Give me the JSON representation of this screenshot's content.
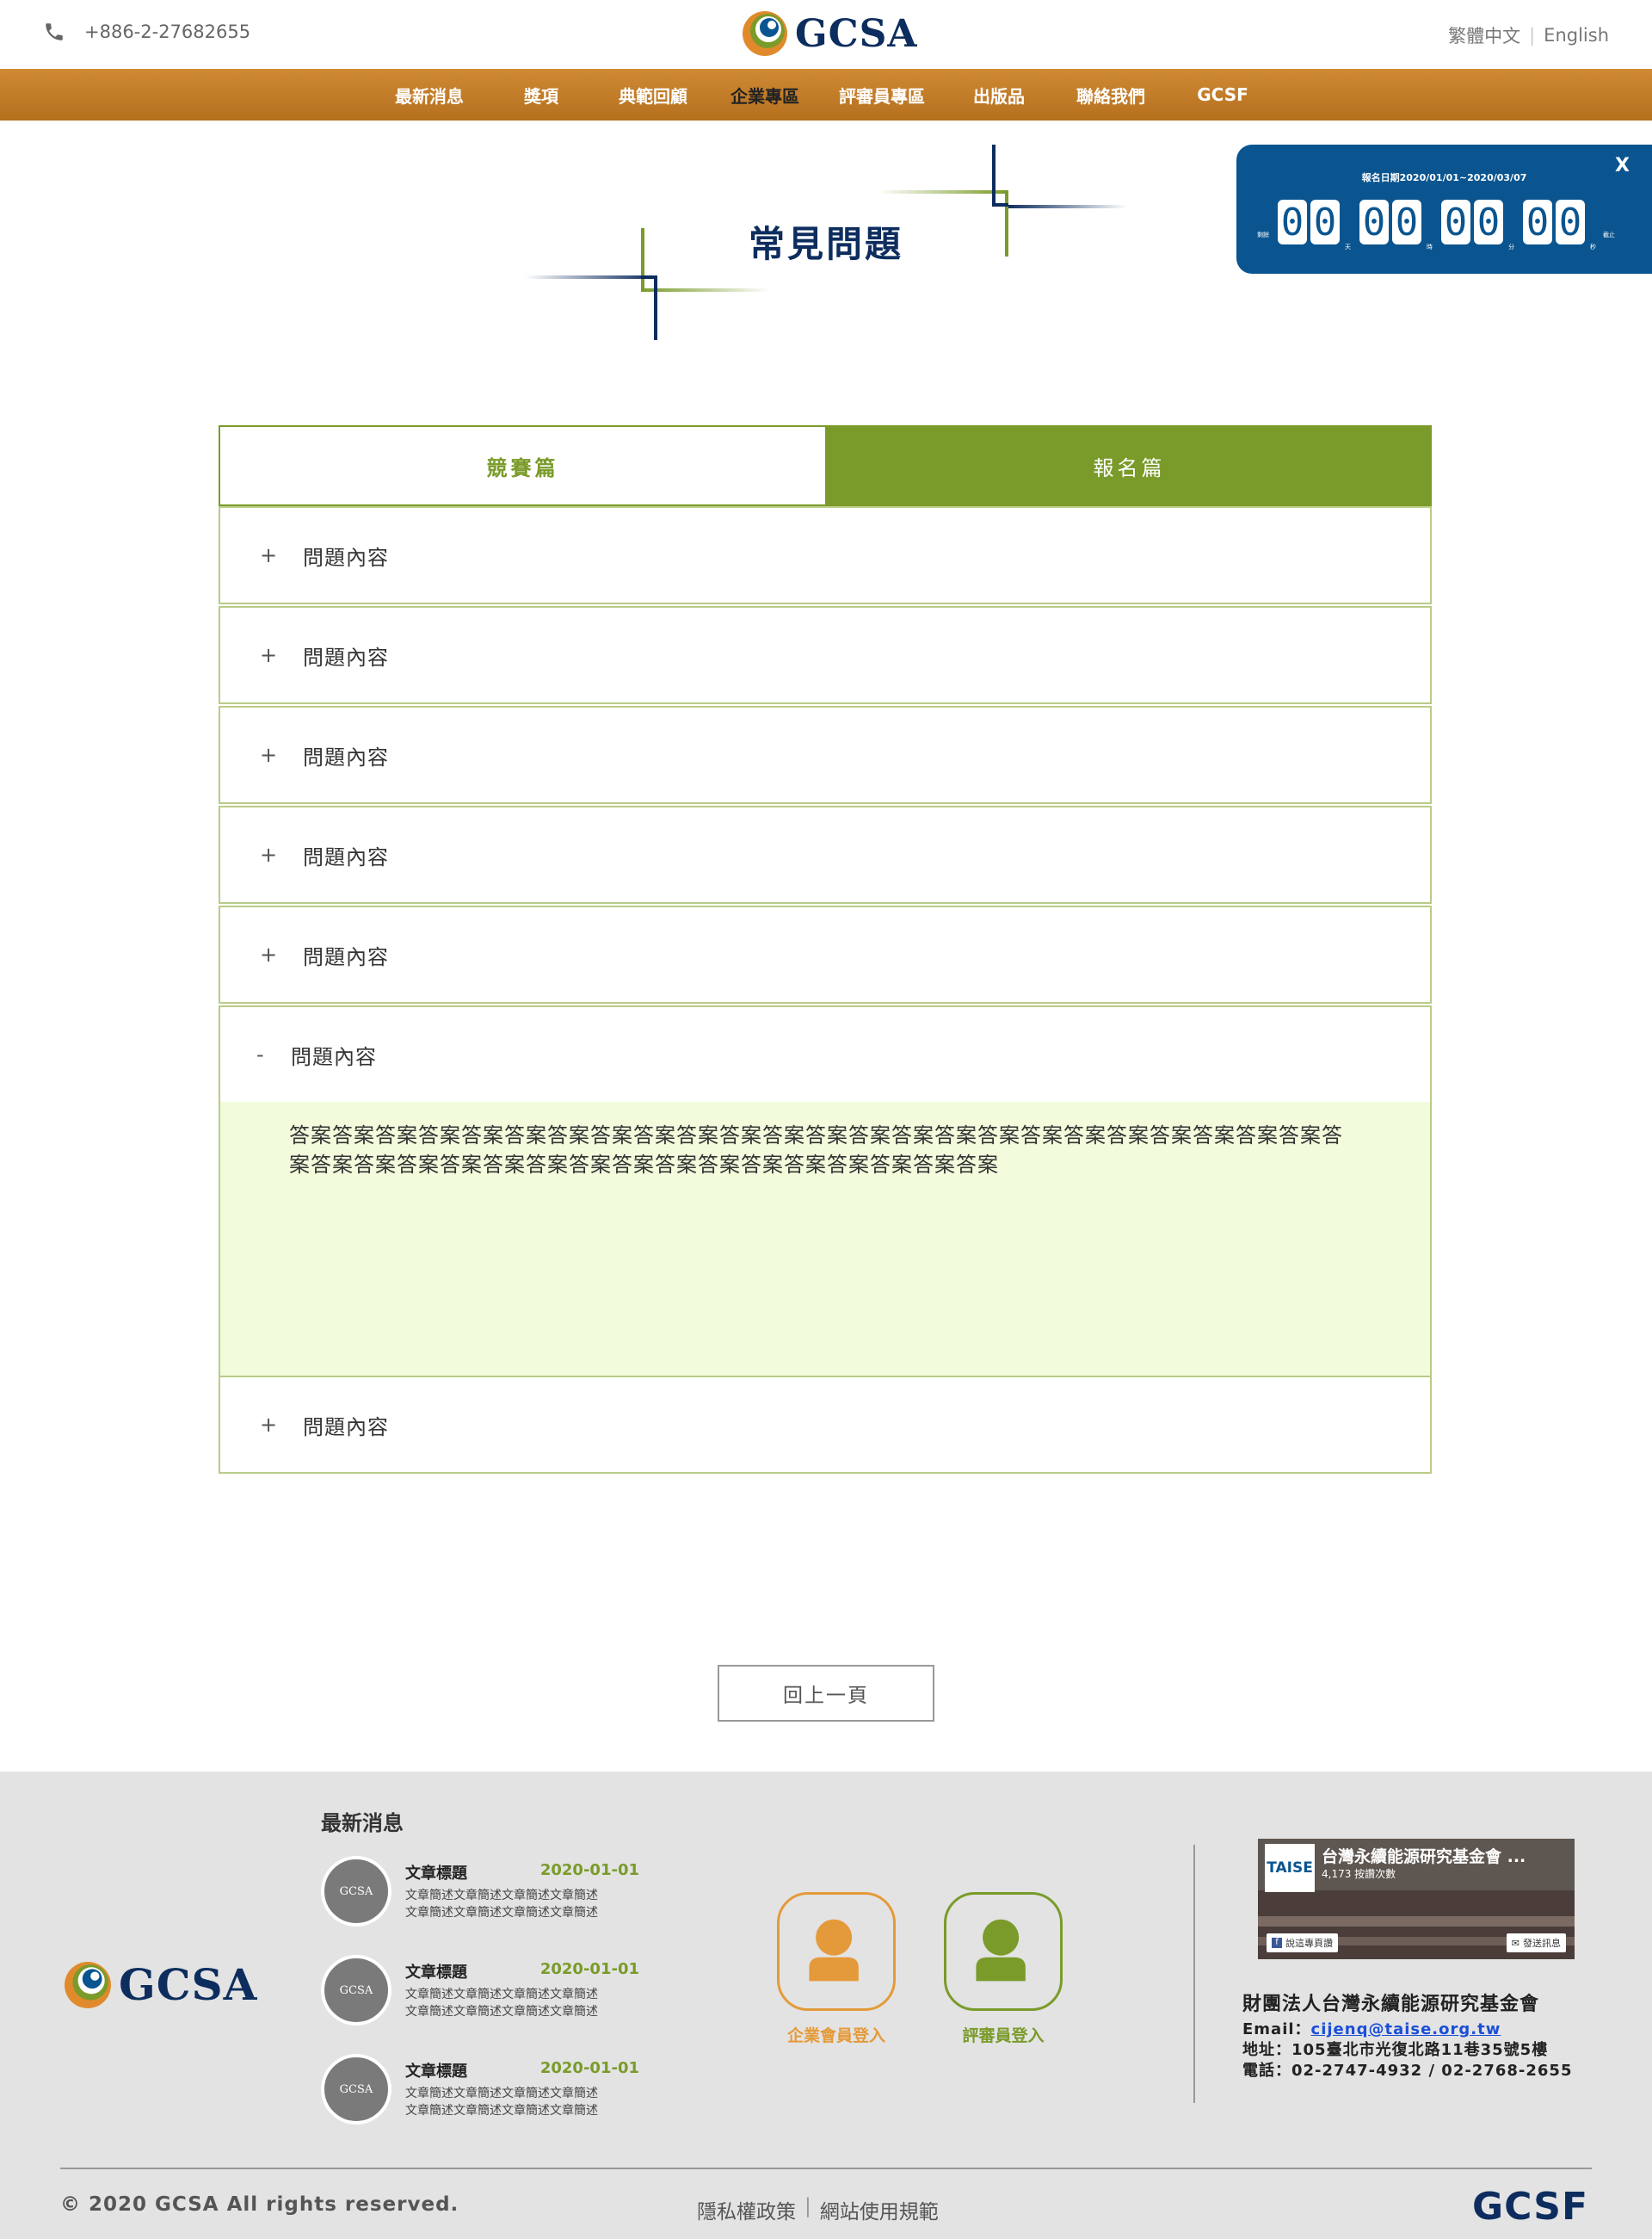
{
  "header": {
    "phone": "+886-2-27682655",
    "logo_text": "GCSA",
    "lang_zh": "繁體中文",
    "lang_en": "English"
  },
  "nav": [
    "最新消息",
    "獎項",
    "典範回顧",
    "企業專區",
    "評審員專區",
    "出版品",
    "聯絡我們",
    "GCSF"
  ],
  "page_title": "常見問題",
  "countdown": {
    "close": "X",
    "date_range": "報名日期2020/01/01~2020/03/07",
    "left_label": "剩餘",
    "right_label": "截止",
    "groups": [
      {
        "digits": [
          "0",
          "0"
        ],
        "unit": "天"
      },
      {
        "digits": [
          "0",
          "0"
        ],
        "unit": "時"
      },
      {
        "digits": [
          "0",
          "0"
        ],
        "unit": "分"
      },
      {
        "digits": [
          "0",
          "0"
        ],
        "unit": "秒"
      }
    ]
  },
  "tabs": {
    "competition": "競賽篇",
    "registration": "報名篇"
  },
  "faq": [
    {
      "sign": "+",
      "question": "問題內容"
    },
    {
      "sign": "+",
      "question": "問題內容"
    },
    {
      "sign": "+",
      "question": "問題內容"
    },
    {
      "sign": "+",
      "question": "問題內容"
    },
    {
      "sign": "+",
      "question": "問題內容"
    },
    {
      "sign": "-",
      "question": "問題內容"
    },
    {
      "sign": "+",
      "question": "問題內容"
    }
  ],
  "answer": "答案答案答案答案答案答案答案答案答案答案答案答案答案答案答案答案答案答案答案答案答案答案答案答案答案答案答案答案答案答案答案答案答案答案答案答案答案答案答案答案答案",
  "back_button": "回上一頁",
  "footer": {
    "logo_text": "GCSA",
    "news_title": "最新消息",
    "news": [
      {
        "thumb": "GCSA",
        "title": "文章標題",
        "date": "2020-01-01",
        "desc1": "文章簡述文章簡述文章簡述文章簡述",
        "desc2": "文章簡述文章簡述文章簡述文章簡述"
      },
      {
        "thumb": "GCSA",
        "title": "文章標題",
        "date": "2020-01-01",
        "desc1": "文章簡述文章簡述文章簡述文章簡述",
        "desc2": "文章簡述文章簡述文章簡述文章簡述"
      },
      {
        "thumb": "GCSA",
        "title": "文章標題",
        "date": "2020-01-01",
        "desc1": "文章簡述文章簡述文章簡述文章簡述",
        "desc2": "文章簡述文章簡述文章簡述文章簡述"
      }
    ],
    "login_company": "企業會員登入",
    "login_judge": "評審員登入",
    "fb": {
      "badge": "TAISE",
      "name": "台灣永續能源研究基金會 ...",
      "likes": "4,173 按讚次數",
      "like_btn": "說這專頁讚",
      "msg_btn": "發送訊息"
    },
    "org_name": "財團法人台灣永續能源研究基金會",
    "email_label": "Email：",
    "email": "cijenq@taise.org.tw",
    "address": "地址：105臺北市光復北路11巷35號5樓",
    "tel": "電話：02-2747-4932 / 02-2768-2655",
    "copyright": "© 2020 GCSA All rights reserved.",
    "privacy": "隱私權政策",
    "terms": "網站使用規範",
    "brand": "GCSF"
  },
  "colors": {
    "nav_orange": "#c17c28",
    "accent_green": "#7a9b2a",
    "navy": "#0d2d5e",
    "countdown_blue": "#0a5590",
    "answer_bg": "#f2fcdc",
    "company_orange": "#e49a3a",
    "judge_green": "#7a9b2a"
  }
}
